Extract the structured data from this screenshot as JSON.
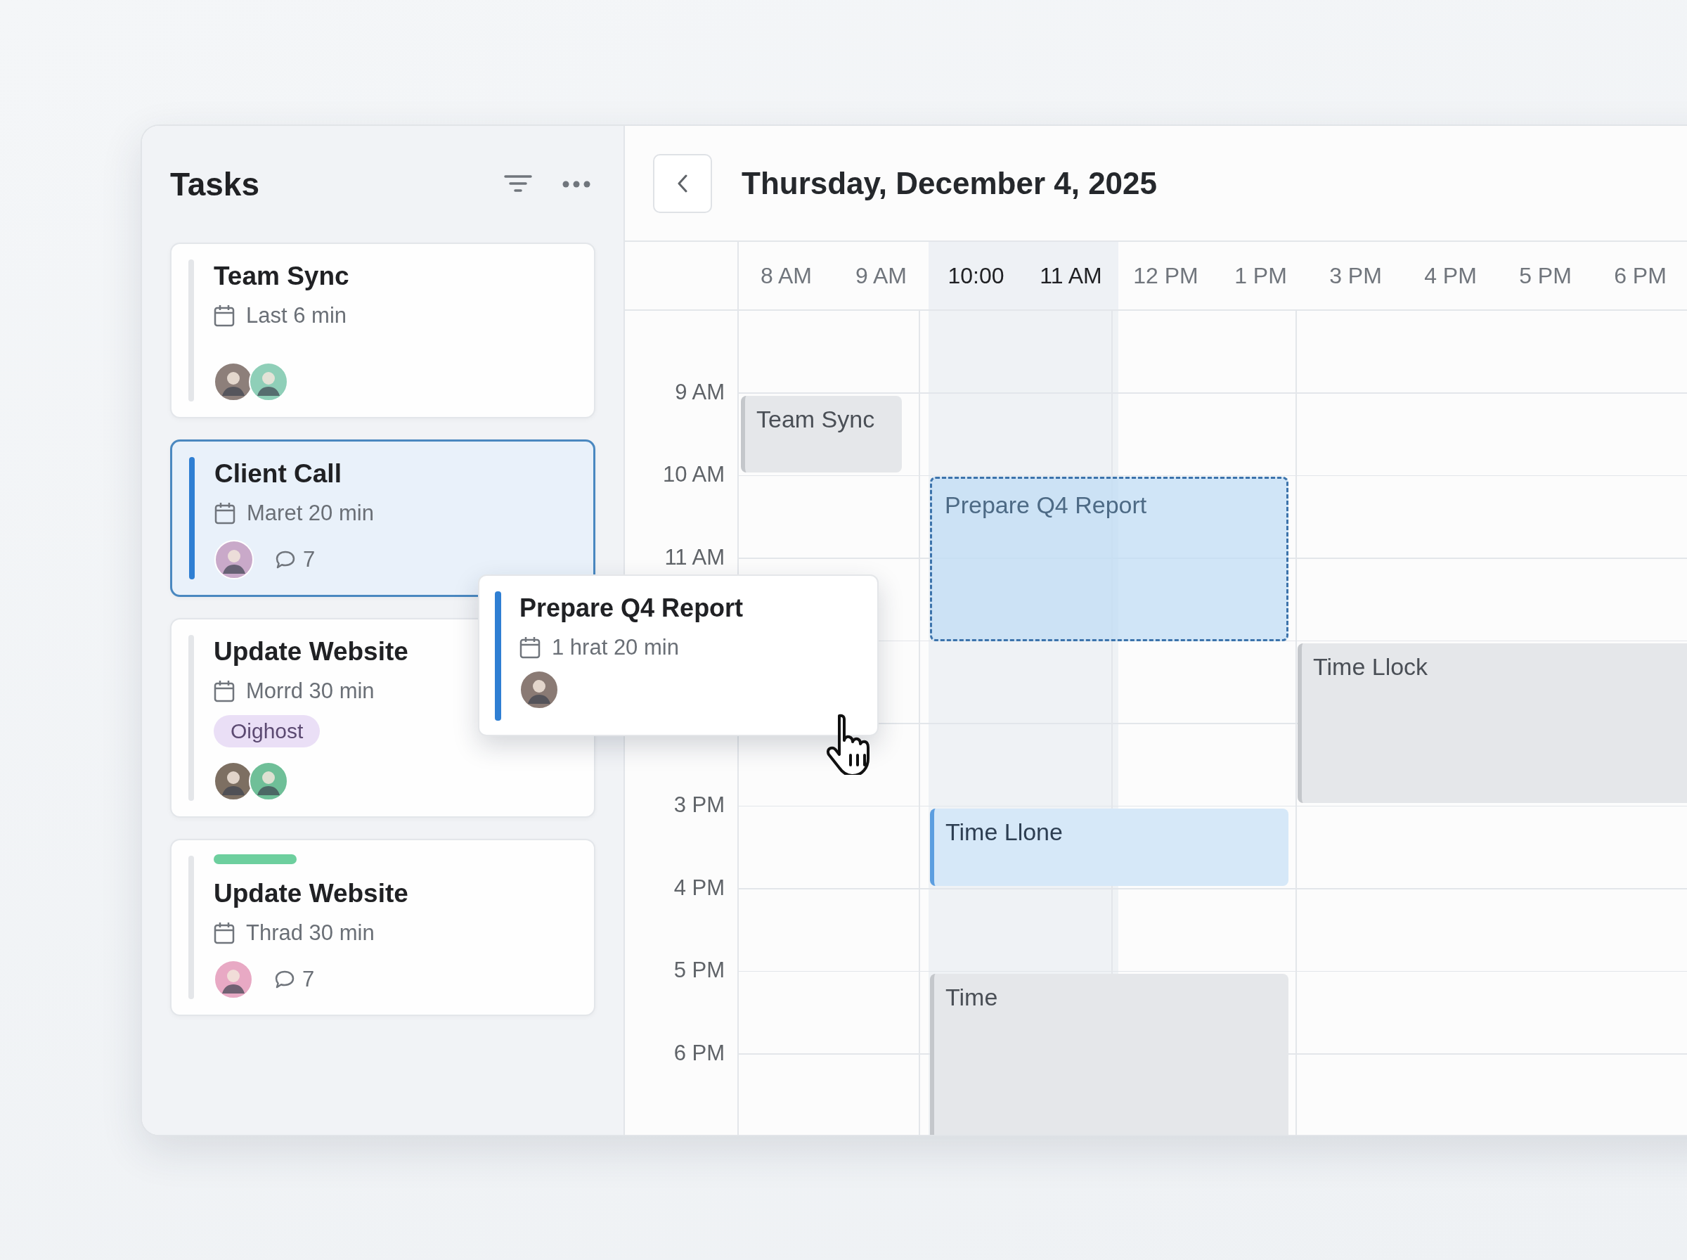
{
  "sidebar": {
    "title": "Tasks",
    "cards": [
      {
        "title": "Team Sync",
        "meta": "Last 6 min",
        "selected": false,
        "avatars": [
          {
            "color": "#8d7f7a"
          },
          {
            "color": "#8fcfb8"
          }
        ]
      },
      {
        "title": "Client Call",
        "meta": "Maret 20 min",
        "selected": true,
        "avatars": [
          {
            "color": "#c9a9c9"
          }
        ],
        "comments": "7"
      },
      {
        "title": "Update Website",
        "meta": "Morrd 30 min",
        "selected": false,
        "tag": "Oighost",
        "avatars": [
          {
            "color": "#7d6f62"
          },
          {
            "color": "#6fbf98"
          }
        ]
      },
      {
        "title": "Update Website",
        "meta": "Thrad 30 min",
        "selected": false,
        "color": "#6dcf9e",
        "avatars": [
          {
            "color": "#e8a9c4"
          }
        ],
        "comments": "7"
      }
    ]
  },
  "calendar": {
    "date": "Thursday, December 4, 2025",
    "hours": [
      {
        "label": "8 AM",
        "selected": false
      },
      {
        "label": "9 AM",
        "selected": false
      },
      {
        "label": "10:00",
        "selected": true
      },
      {
        "label": "11 AM",
        "selected": true
      },
      {
        "label": "12 PM",
        "selected": false
      },
      {
        "label": "1 PM",
        "selected": false
      },
      {
        "label": "3 PM",
        "selected": false
      },
      {
        "label": "4 PM",
        "selected": false
      },
      {
        "label": "5 PM",
        "selected": false
      },
      {
        "label": "6 PM",
        "selected": false
      }
    ],
    "time_labels": [
      "9 AM",
      "10 AM",
      "11 AM",
      "3 PM",
      "4 PM",
      "5 PM",
      "6 PM"
    ],
    "events": [
      {
        "title": "Team Sync",
        "kind": "block"
      },
      {
        "title": "Prepare Q4 Report",
        "kind": "ghost"
      },
      {
        "title": "Time Llock",
        "kind": "block"
      },
      {
        "title": "Time Llone",
        "kind": "scheduled"
      },
      {
        "title": "Time",
        "kind": "block"
      }
    ]
  },
  "drag_card": {
    "title": "Prepare Q4 Report",
    "meta": "1 hrat 20 min",
    "avatars": [
      {
        "color": "#8a7a74"
      }
    ]
  }
}
